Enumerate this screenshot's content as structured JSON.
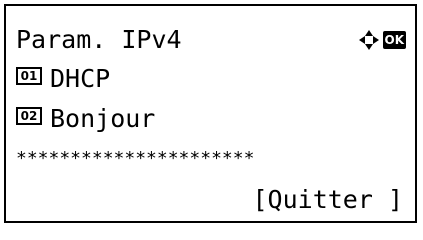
{
  "screen": {
    "title": "Param. IPv4",
    "ok_label": "OK",
    "items": [
      {
        "number": "01",
        "label": "DHCP"
      },
      {
        "number": "02",
        "label": "Bonjour"
      }
    ],
    "partial_row": "**********************",
    "softkey": "[Quitter ]"
  }
}
